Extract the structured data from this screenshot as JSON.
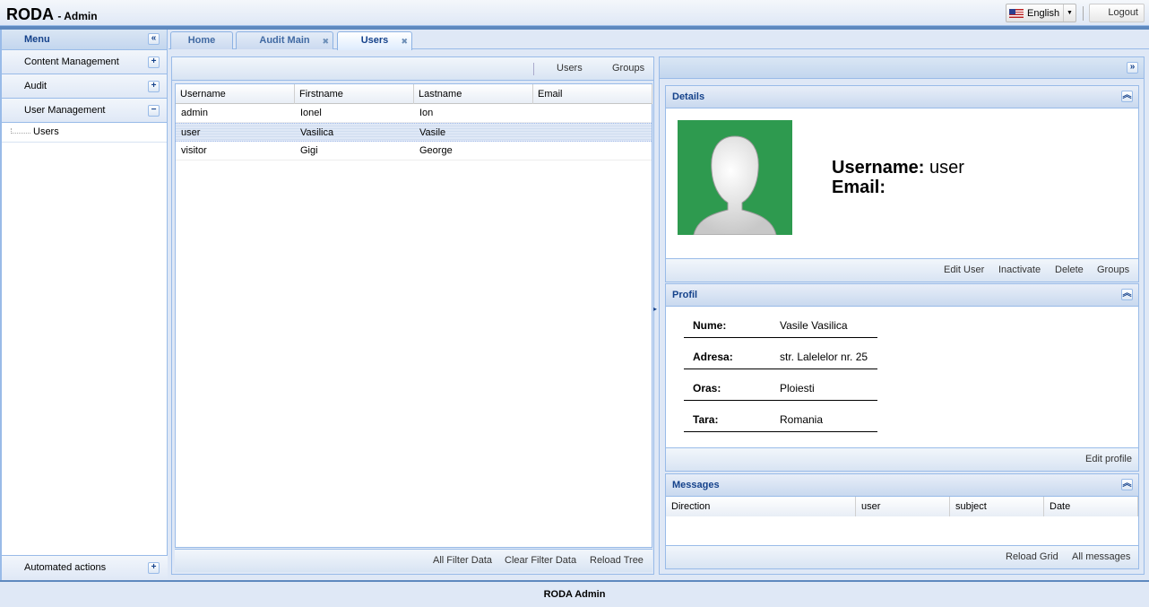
{
  "app": {
    "title": "RODA",
    "subtitle": "- Admin"
  },
  "header": {
    "language": "English",
    "logout": "Logout"
  },
  "menu": {
    "title": "Menu",
    "items": [
      {
        "label": "Content Management",
        "state": "collapsed"
      },
      {
        "label": "Audit",
        "state": "collapsed"
      },
      {
        "label": "User Management",
        "state": "expanded"
      }
    ],
    "subitems": [
      "Users"
    ],
    "bottom_item": "Automated actions"
  },
  "tabs": [
    {
      "label": "Home",
      "closable": false
    },
    {
      "label": "Audit Main",
      "closable": true
    },
    {
      "label": "Users",
      "closable": true,
      "active": true
    }
  ],
  "grid": {
    "toolbar": [
      "Users",
      "Groups"
    ],
    "columns": [
      "Username",
      "Firstname",
      "Lastname",
      "Email"
    ],
    "rows": [
      [
        "admin",
        "Ionel",
        "Ion",
        ""
      ],
      [
        "user",
        "Vasilica",
        "Vasile",
        ""
      ],
      [
        "visitor",
        "Gigi",
        "George",
        ""
      ]
    ],
    "selected_row": 1,
    "footer": [
      "All Filter Data",
      "Clear Filter Data",
      "Reload Tree"
    ]
  },
  "details": {
    "title": "Details",
    "username_label": "Username:",
    "username_value": "user",
    "email_label": "Email:",
    "actions": [
      "Edit User",
      "Inactivate",
      "Delete",
      "Groups"
    ]
  },
  "profil": {
    "title": "Profil",
    "rows": [
      {
        "k": "Nume:",
        "v": "Vasile Vasilica"
      },
      {
        "k": "Adresa:",
        "v": "str. Lalelelor nr. 25"
      },
      {
        "k": "Oras:",
        "v": "Ploiesti"
      },
      {
        "k": "Tara:",
        "v": "Romania"
      }
    ],
    "edit": "Edit profile"
  },
  "messages": {
    "title": "Messages",
    "columns": [
      "Direction",
      "user",
      "subject",
      "Date"
    ],
    "footer": [
      "Reload Grid",
      "All messages"
    ]
  },
  "footer": {
    "text": "RODA Admin"
  },
  "colors": {
    "accent": "#15428b",
    "border": "#99bbe8",
    "avatar_bg": "#2e9a4f"
  }
}
